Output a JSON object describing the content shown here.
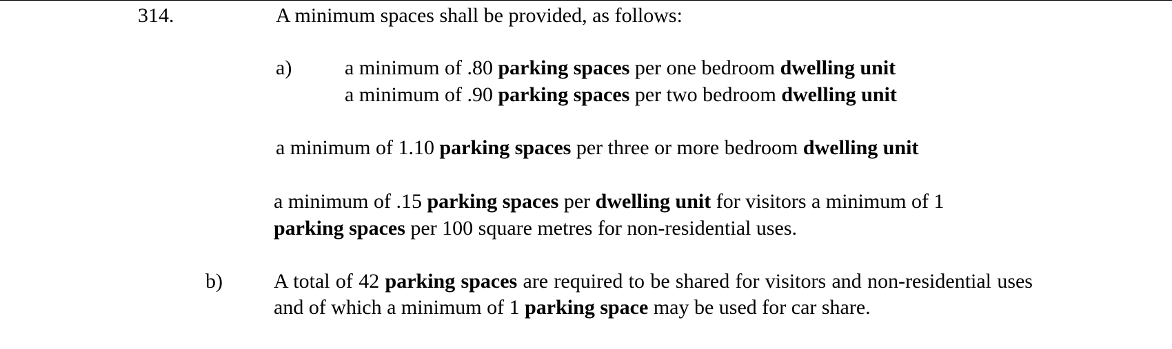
{
  "section": {
    "number": "314.",
    "intro": "A minimum spaces shall be provided, as follows:"
  },
  "item_a": {
    "marker": "a)",
    "line1": {
      "prefix": "a minimum of .80 ",
      "term1": "parking spaces",
      "middle": " per one bedroom ",
      "term2": "dwelling unit"
    },
    "line2": {
      "prefix": "a minimum of .90 ",
      "term1": "parking spaces",
      "middle": " per two bedroom ",
      "term2": "dwelling unit"
    },
    "three_bedroom": {
      "prefix": "a minimum of 1.10 ",
      "term1": "parking spaces",
      "middle": " per three or more bedroom ",
      "term2": "dwelling unit"
    },
    "visitors": {
      "prefix": "a minimum of .15 ",
      "term1": "parking spaces",
      "middle1": " per ",
      "term2": "dwelling unit",
      "suffix1": " for visitors a minimum of 1",
      "term3": "parking spaces",
      "suffix2": " per 100 square metres for non-residential uses."
    }
  },
  "item_b": {
    "marker": "b)",
    "text1": "A total of 42 ",
    "term1": "parking spaces",
    "text2": " are required to be shared for visitors and non-residential uses and of which a minimum of 1 ",
    "term2": "parking space",
    "text3": " may be used for car share."
  }
}
